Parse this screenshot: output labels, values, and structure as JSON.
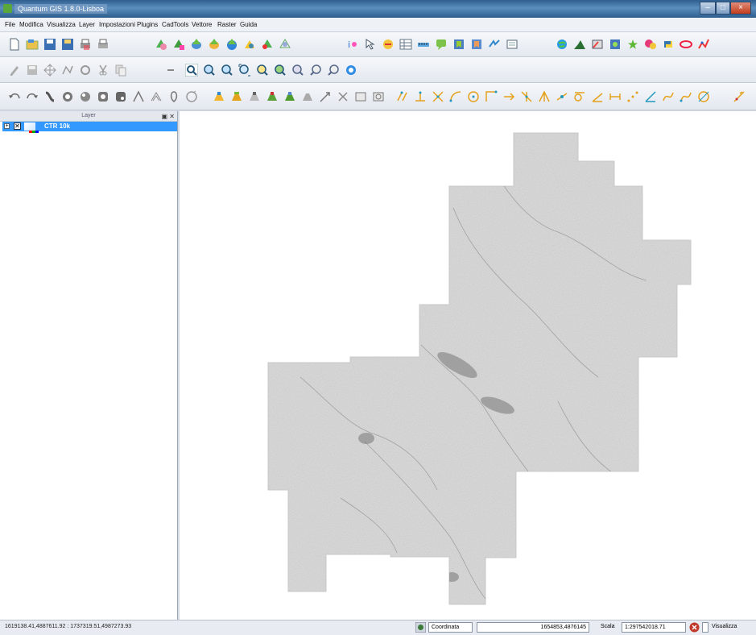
{
  "window": {
    "title": "Quantum GIS 1.8.0-Lisboa",
    "controls": [
      "–",
      "□",
      "×"
    ]
  },
  "menu": [
    "File",
    "Modifica",
    "Visualizza",
    "Layer",
    "Impostazioni",
    "Plugins",
    "CadTools",
    "Vettore",
    "Raster",
    "Guida"
  ],
  "layer_panel": {
    "title": "Layer",
    "buttons": "▣ ✕",
    "layers": [
      {
        "name": "CTR 10k",
        "visible": true,
        "expanded": false
      }
    ]
  },
  "status": {
    "extent": "1619138.41,4887611.92 : 1737319.51,4987273.93",
    "coord_label": "Coordinata",
    "coord_value": "1654853,4876145",
    "scale_label": "Scala",
    "scale_value": "1:297542018.71",
    "render_label": "Visualizza"
  },
  "colors": {
    "selection": "#3399ff",
    "titlebar": "#2f5e8f",
    "raster_fill": "#d8d8d8"
  }
}
